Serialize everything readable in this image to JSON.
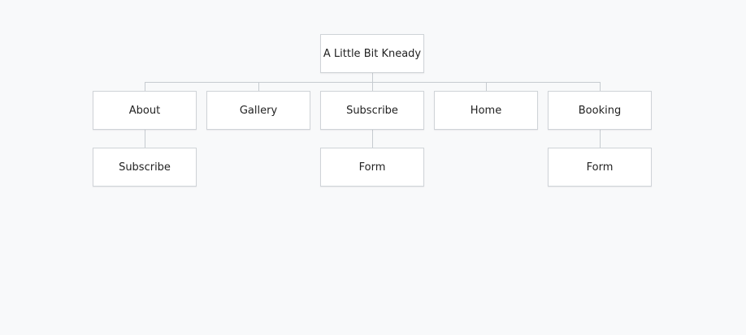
{
  "sitemap": {
    "root": {
      "label": "A Little Bit Kneady"
    },
    "children": [
      {
        "label": "About",
        "children": [
          {
            "label": "Subscribe"
          }
        ]
      },
      {
        "label": "Gallery",
        "children": []
      },
      {
        "label": "Subscribe",
        "children": [
          {
            "label": "Form"
          }
        ]
      },
      {
        "label": "Home",
        "children": []
      },
      {
        "label": "Booking",
        "children": [
          {
            "label": "Form"
          }
        ]
      }
    ]
  },
  "colors": {
    "background": "#f8f9fa",
    "node_fill": "#ffffff",
    "node_border": "#cfd3d7",
    "connector": "#c6cbd0",
    "text": "#222222"
  }
}
